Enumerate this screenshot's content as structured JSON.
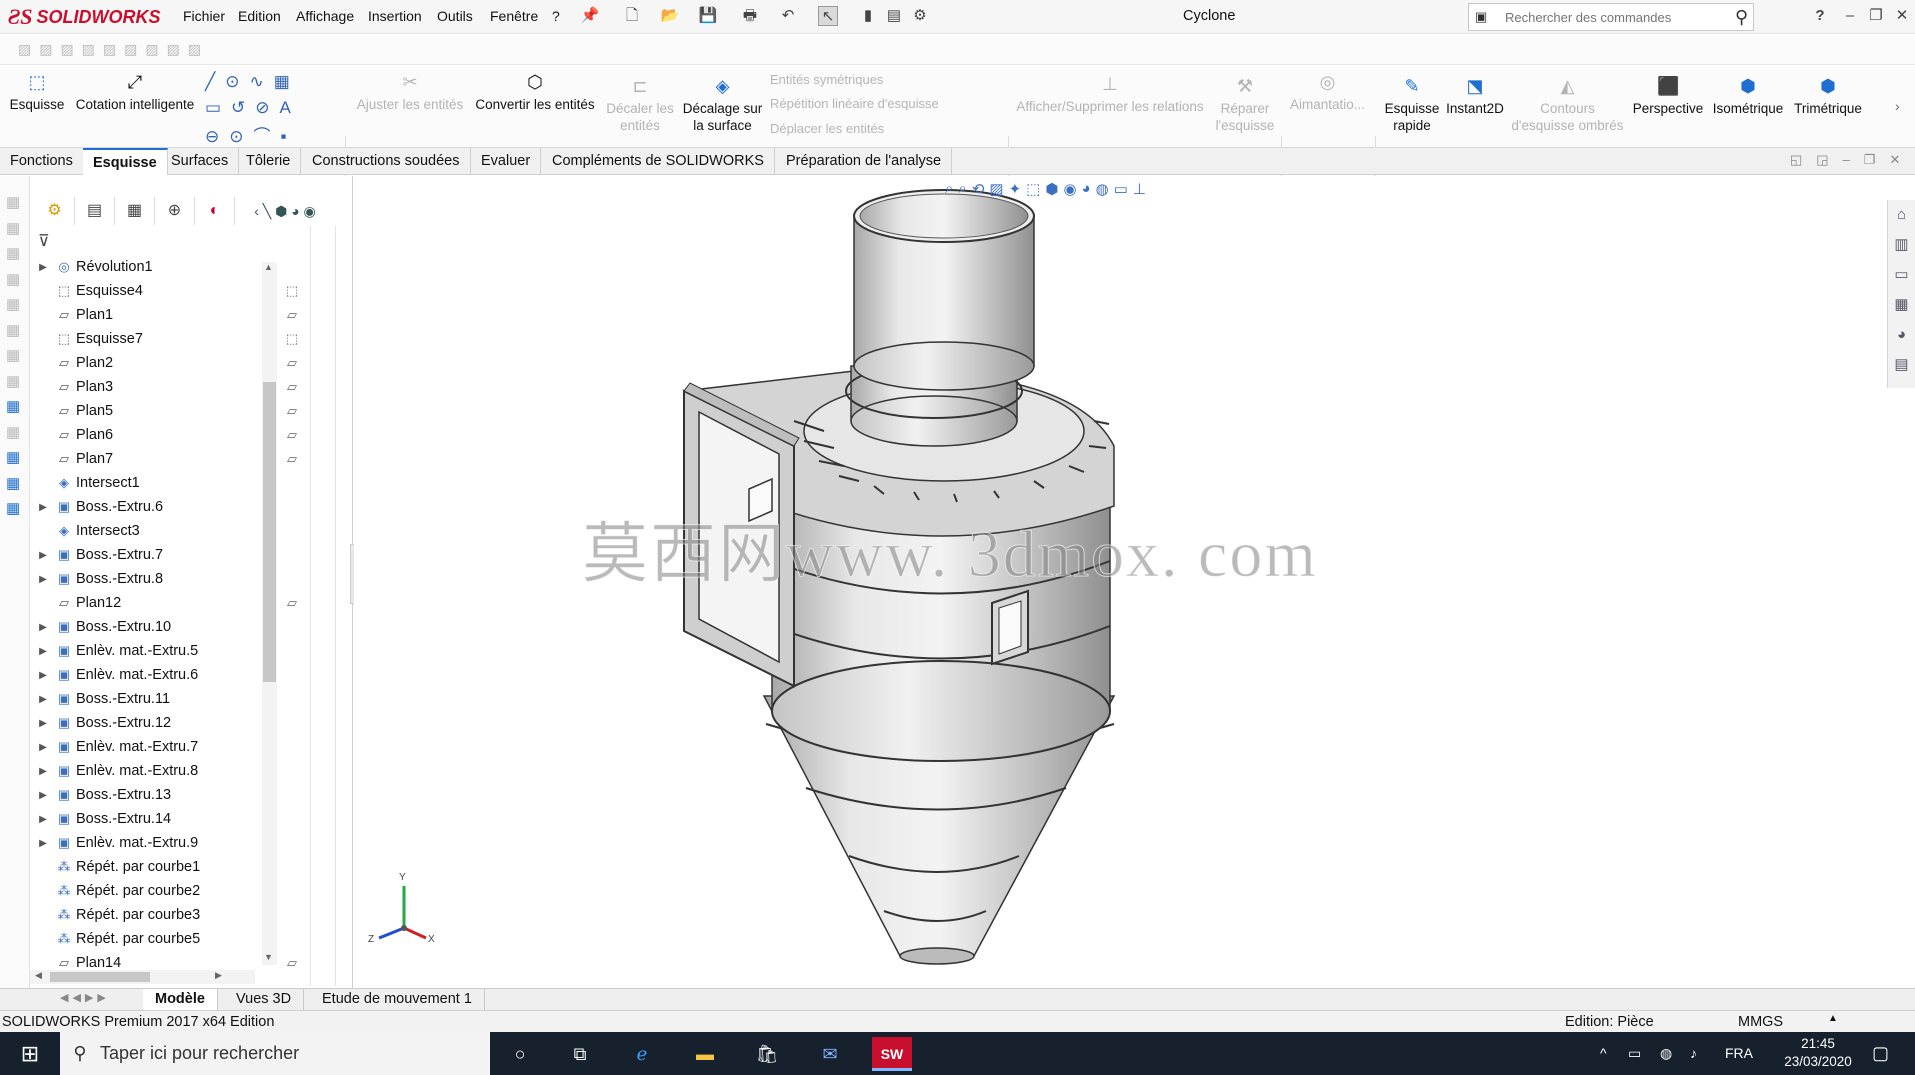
{
  "app": {
    "brand": "SOLIDWORKS",
    "title": "Cyclone"
  },
  "menu": [
    "Fichier",
    "Edition",
    "Affichage",
    "Insertion",
    "Outils",
    "Fenêtre",
    "?"
  ],
  "search": {
    "placeholder": "Rechercher des commandes",
    "value": ""
  },
  "ribbon": {
    "esquisse": "Esquisse",
    "cotation": "Cotation intelligente",
    "ajuster": "Ajuster les entités",
    "convertir": "Convertir les entités",
    "decaler_line1": "Décaler les",
    "decaler_line2": "entités",
    "decalage_line1": "Décalage sur",
    "decalage_line2": "la surface",
    "sym": "Entités symétriques",
    "rep": "Répétition linéaire d'esquisse",
    "depl": "Déplacer les entités",
    "relations": "Afficher/Supprimer les relations",
    "reparer_line1": "Réparer",
    "reparer_line2": "l'esquisse",
    "aimantation": "Aimantatio...",
    "rapide_line1": "Esquisse",
    "rapide_line2": "rapide",
    "instant2d": "Instant2D",
    "contours_line1": "Contours",
    "contours_line2": "d'esquisse ombrés",
    "perspective": "Perspective",
    "isometrique": "Isométrique",
    "trimetrique": "Trimétrique"
  },
  "tabs": [
    "Fonctions",
    "Esquisse",
    "Surfaces",
    "Tôlerie",
    "Constructions soudées",
    "Evaluer",
    "Compléments de SOLIDWORKS",
    "Préparation de l'analyse"
  ],
  "active_tab": "Esquisse",
  "tree": [
    {
      "label": "Révolution1",
      "icon": "revolve-icon",
      "expand": true
    },
    {
      "label": "Esquisse4",
      "icon": "sketch-icon",
      "expand": false
    },
    {
      "label": "Plan1",
      "icon": "plane-icon",
      "expand": false
    },
    {
      "label": "Esquisse7",
      "icon": "sketch-icon",
      "expand": false
    },
    {
      "label": "Plan2",
      "icon": "plane-icon",
      "expand": false
    },
    {
      "label": "Plan3",
      "icon": "plane-icon",
      "expand": false
    },
    {
      "label": "Plan5",
      "icon": "plane-icon",
      "expand": false
    },
    {
      "label": "Plan6",
      "icon": "plane-icon",
      "expand": false
    },
    {
      "label": "Plan7",
      "icon": "plane-icon",
      "expand": false
    },
    {
      "label": "Intersect1",
      "icon": "intersect-icon",
      "expand": false
    },
    {
      "label": "Boss.-Extru.6",
      "icon": "extrude-icon",
      "expand": true
    },
    {
      "label": "Intersect3",
      "icon": "intersect-icon",
      "expand": false
    },
    {
      "label": "Boss.-Extru.7",
      "icon": "extrude-icon",
      "expand": true
    },
    {
      "label": "Boss.-Extru.8",
      "icon": "extrude-icon",
      "expand": true
    },
    {
      "label": "Plan12",
      "icon": "plane-icon",
      "expand": false
    },
    {
      "label": "Boss.-Extru.10",
      "icon": "extrude-icon",
      "expand": true
    },
    {
      "label": "Enlèv. mat.-Extru.5",
      "icon": "cut-icon",
      "expand": true
    },
    {
      "label": "Enlèv. mat.-Extru.6",
      "icon": "cut-icon",
      "expand": true
    },
    {
      "label": "Boss.-Extru.11",
      "icon": "extrude-icon",
      "expand": true
    },
    {
      "label": "Boss.-Extru.12",
      "icon": "extrude-icon",
      "expand": true
    },
    {
      "label": "Enlèv. mat.-Extru.7",
      "icon": "cut-icon",
      "expand": true
    },
    {
      "label": "Enlèv. mat.-Extru.8",
      "icon": "cut-icon",
      "expand": true
    },
    {
      "label": "Boss.-Extru.13",
      "icon": "extrude-icon",
      "expand": true
    },
    {
      "label": "Boss.-Extru.14",
      "icon": "extrude-icon",
      "expand": true
    },
    {
      "label": "Enlèv. mat.-Extru.9",
      "icon": "cut-icon",
      "expand": true
    },
    {
      "label": "Répét. par courbe1",
      "icon": "pattern-icon",
      "expand": false
    },
    {
      "label": "Répét. par courbe2",
      "icon": "pattern-icon",
      "expand": false
    },
    {
      "label": "Répét. par courbe3",
      "icon": "pattern-icon",
      "expand": false
    },
    {
      "label": "Répét. par courbe5",
      "icon": "pattern-icon",
      "expand": false
    },
    {
      "label": "Plan14",
      "icon": "plane-icon",
      "expand": false
    }
  ],
  "watermark": "莫西网www. 3dmox. com",
  "triad": {
    "x": "X",
    "y": "Y",
    "z": "Z"
  },
  "bottom_tabs": [
    "Modèle",
    "Vues 3D",
    "Etude de mouvement 1"
  ],
  "status": {
    "left": "SOLIDWORKS Premium 2017 x64 Edition",
    "mode": "Edition: Pièce",
    "units": "MMGS"
  },
  "taskbar": {
    "search": "Taper ici pour rechercher",
    "lang": "FRA",
    "time": "21:45",
    "date": "23/03/2020"
  },
  "colors": {
    "brand": "#c8102e",
    "accent": "#1f6fd0",
    "taskbar": "#16212d"
  }
}
